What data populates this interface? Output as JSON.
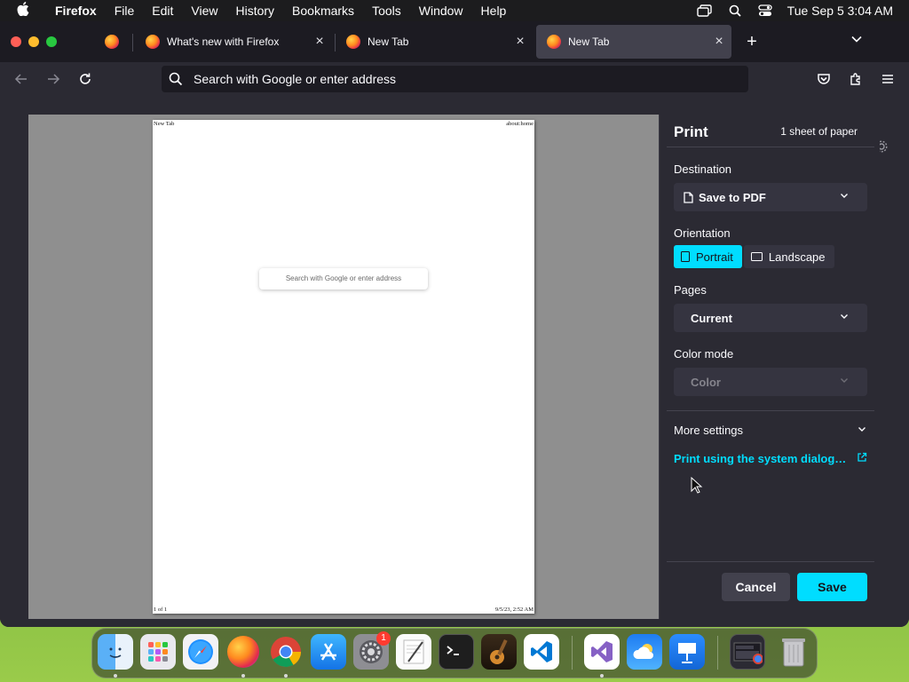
{
  "menubar": {
    "app_name": "Firefox",
    "items": [
      "File",
      "Edit",
      "View",
      "History",
      "Bookmarks",
      "Tools",
      "Window",
      "Help"
    ],
    "clock": "Tue Sep 5  3:04 AM"
  },
  "tabs": [
    {
      "title": "What's new with Firefox",
      "active": false
    },
    {
      "title": "New Tab",
      "active": false
    },
    {
      "title": "New Tab",
      "active": true
    }
  ],
  "tab_close_glyph": "×",
  "new_tab_glyph": "+",
  "urlbar": {
    "placeholder": "Search with Google or enter address"
  },
  "preview": {
    "header_left": "New Tab",
    "header_right": "about:home",
    "search_text": "Search with Google or enter address",
    "footer_left": "1 of 1",
    "footer_right": "9/5/23, 2:52 AM"
  },
  "print": {
    "title": "Print",
    "sheet_count": "1 sheet of paper",
    "destination_label": "Destination",
    "destination_value": "Save to PDF",
    "orientation_label": "Orientation",
    "orientation_options": [
      "Portrait",
      "Landscape"
    ],
    "orientation_selected": "Portrait",
    "pages_label": "Pages",
    "pages_value": "Current",
    "color_mode_label": "Color mode",
    "color_mode_value": "Color",
    "more_settings": "More settings",
    "system_dialog_link": "Print using the system dialog…",
    "cancel": "Cancel",
    "save": "Save"
  },
  "dock": {
    "apps": [
      "finder-icon",
      "launchpad-icon",
      "safari-icon",
      "firefox-icon",
      "chrome-icon",
      "app-store-icon",
      "system-settings-icon",
      "textedit-icon",
      "terminal-icon",
      "garageband-icon",
      "vscode-icon",
      "visual-studio-icon",
      "weather-icon",
      "keynote-icon",
      "minimized-window-icon",
      "trash-icon"
    ],
    "system_settings_badge": "1"
  },
  "colors": {
    "accent": "#00ddff",
    "panel_bg": "#2b2a33",
    "toolbar_bg": "#2b2a33",
    "tabstrip_bg": "#1c1b22"
  }
}
